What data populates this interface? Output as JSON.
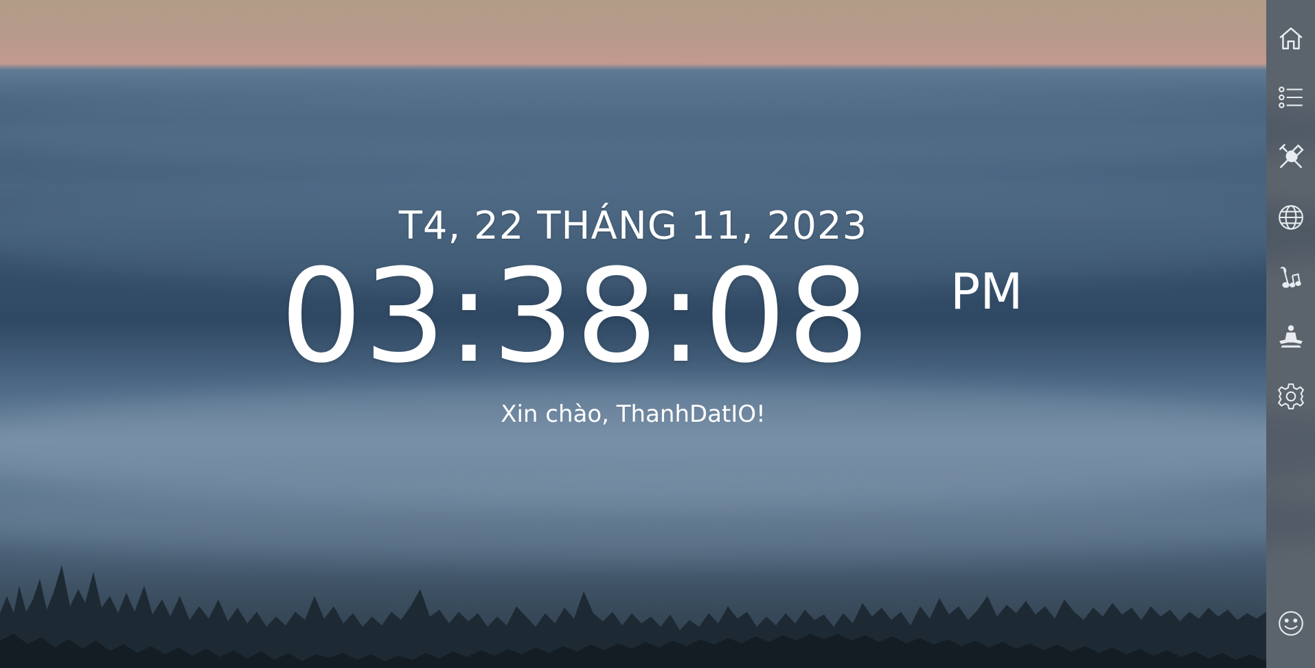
{
  "clock": {
    "date": "T4, 22 THÁNG 11, 2023",
    "time": "03:38:08",
    "ampm": "PM",
    "greeting": "Xin chào, ThanhDatIO!"
  },
  "sidebar": {
    "items": [
      {
        "icon": "home-icon"
      },
      {
        "icon": "list-icon"
      },
      {
        "icon": "tools-icon"
      },
      {
        "icon": "globe-icon"
      },
      {
        "icon": "music-icon"
      },
      {
        "icon": "meditation-icon"
      },
      {
        "icon": "gear-icon"
      }
    ],
    "bottom_icon": "smiley-icon"
  },
  "colors": {
    "text": "#ffffff",
    "sidebar_bg": "#2d3742",
    "icon": "#e8ecf0"
  }
}
